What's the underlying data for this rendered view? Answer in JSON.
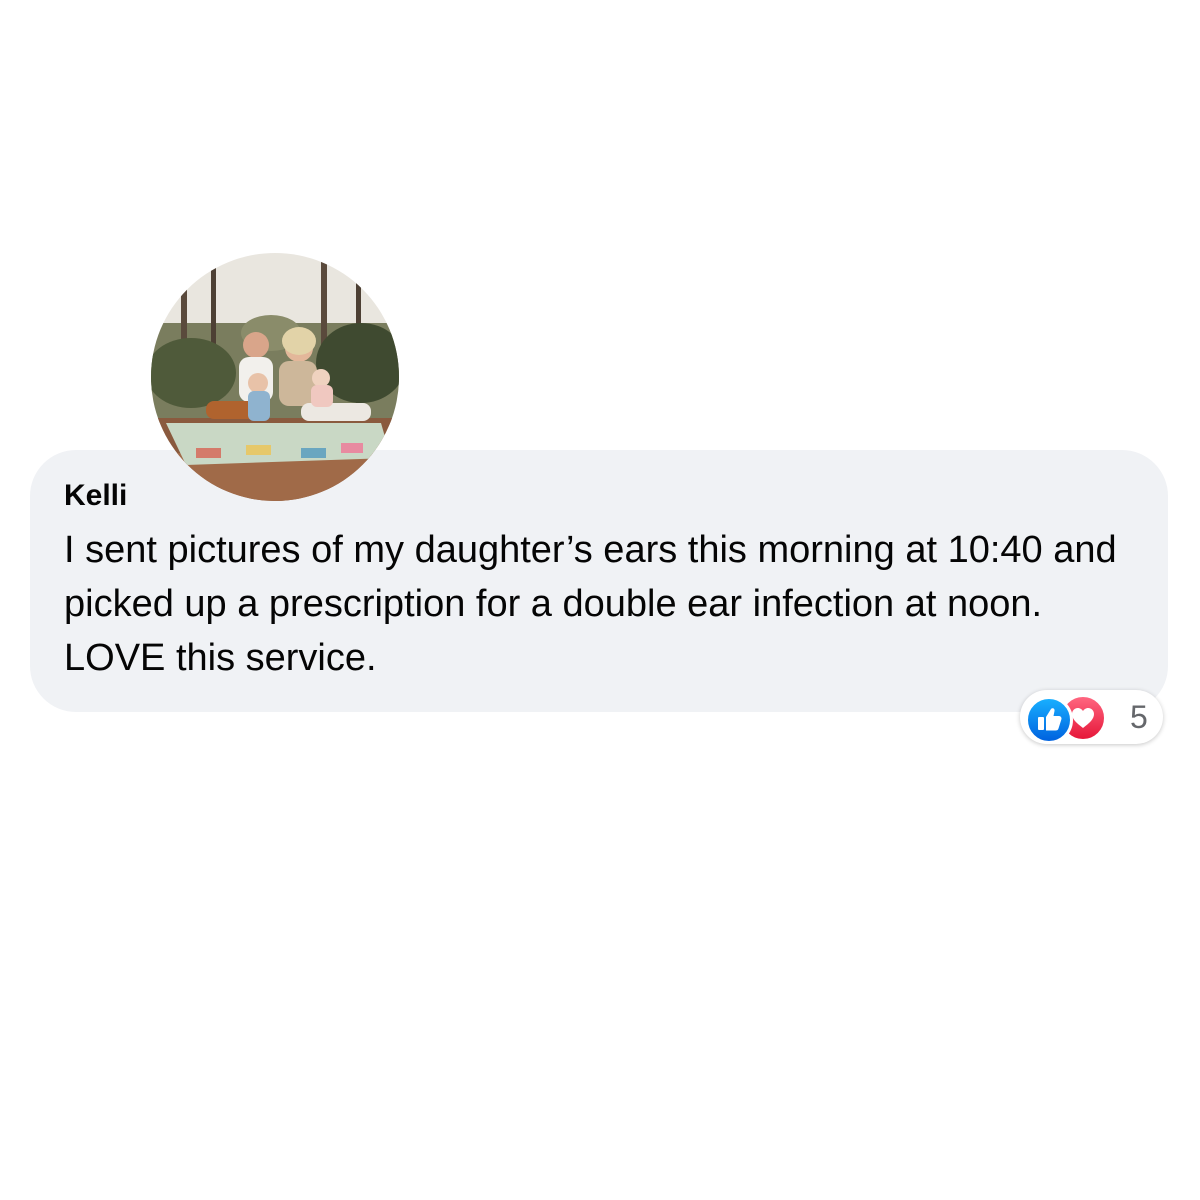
{
  "comment": {
    "author": "Kelli",
    "text": "I sent pictures of my daughter’s ears this morning at 10:40 and picked up a prescription for a double ear infection at noon. LOVE this service.",
    "avatar": "family-photo-avatar"
  },
  "reactions": {
    "icons": [
      "like-icon",
      "love-icon"
    ],
    "count": "5"
  },
  "colors": {
    "bubble": "#f0f2f5",
    "like": "#1877f2",
    "love": "#f33e58",
    "count": "#65676b"
  }
}
